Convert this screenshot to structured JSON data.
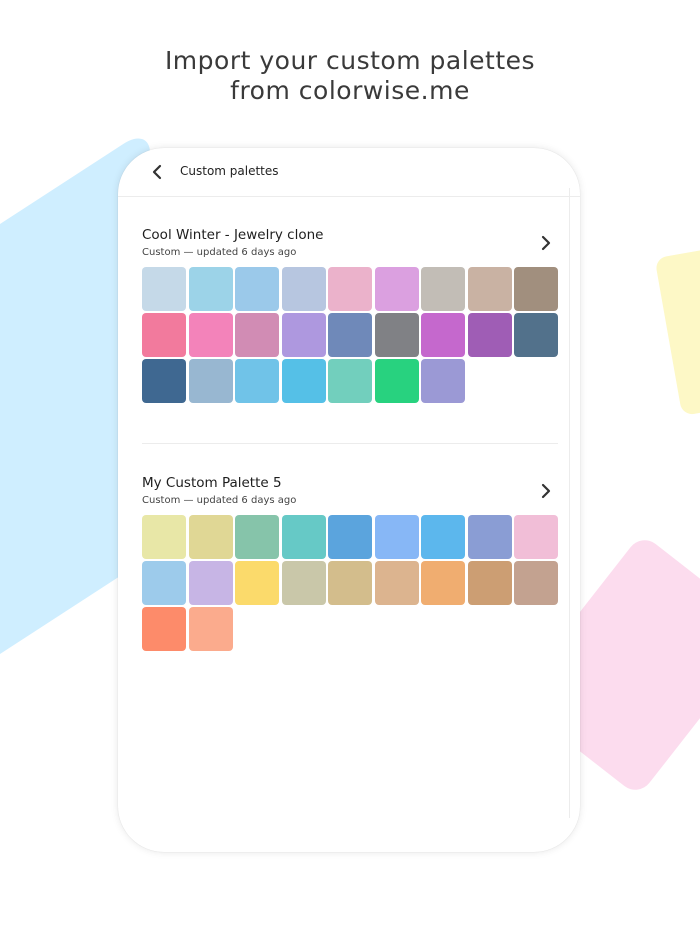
{
  "headline": {
    "line1": "Import your custom palettes",
    "line2": "from colorwise.me"
  },
  "app_bar": {
    "title": "Custom palettes",
    "back_icon": "chevron-left-icon"
  },
  "palettes": [
    {
      "name": "Cool Winter - Jewelry clone",
      "subtitle": "Custom — updated 6 days ago",
      "open_icon": "chevron-right-icon",
      "colors": [
        "#c5d9e8",
        "#9cd3e8",
        "#9bc9ea",
        "#b7c6e0",
        "#ebb2cb",
        "#dba0e0",
        "#c2bdb6",
        "#c9b2a3",
        "#a18f7e",
        "#f27a9d",
        "#f383ba",
        "#d18cb4",
        "#ae98df",
        "#6f89b9",
        "#808185",
        "#c568cd",
        "#9f5db5",
        "#52718b",
        "#3f6891",
        "#98b7d1",
        "#70c3e8",
        "#55c0e7",
        "#72cfbd",
        "#28d27f",
        "#9b99d5"
      ]
    },
    {
      "name": "My Custom Palette 5",
      "subtitle": "Custom — updated 6 days ago",
      "open_icon": "chevron-right-icon",
      "colors": [
        "#e8e7a7",
        "#e0d795",
        "#86c4aa",
        "#66c9c6",
        "#5ba4dd",
        "#87b7f6",
        "#5cb7ed",
        "#8a9dd4",
        "#f1bed7",
        "#9dcbeb",
        "#c7b5e5",
        "#fbda6b",
        "#c9c7a9",
        "#d3bd8c",
        "#dcb48f",
        "#f0ad70",
        "#cc9e73",
        "#c3a290",
        "#fd8b6a",
        "#fbab8d"
      ]
    }
  ]
}
